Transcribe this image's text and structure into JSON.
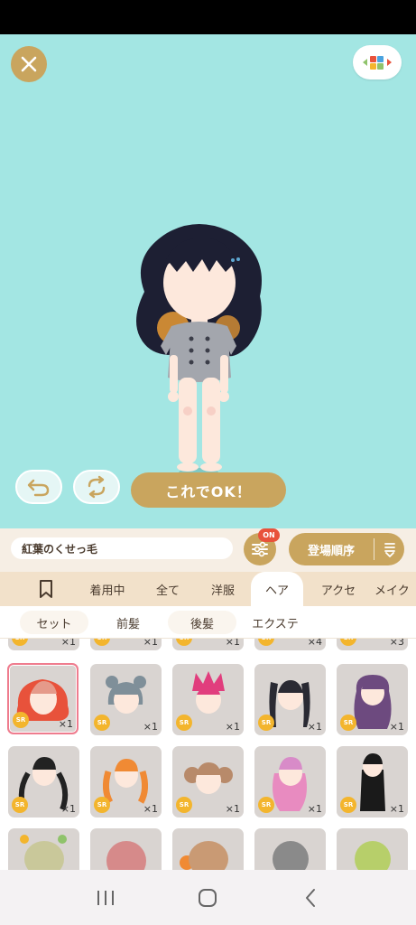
{
  "colors": {
    "stage_bg": "#a3e6e3",
    "gold": "#c9a55e",
    "badge_red": "#e8523b",
    "tab_bar": "#f2e1ca",
    "selected_border": "#ef7c8e"
  },
  "header": {
    "close_icon": "close-x-icon",
    "palette_icon": "color-palette-icon"
  },
  "actions": {
    "undo_icon": "undo-arrow-icon",
    "swap_icon": "swap-cycle-icon",
    "ok_label": "これでOK！"
  },
  "toolbar": {
    "item_name": "紅葉のくせっ毛",
    "filter_badge": "ON",
    "sort_label": "登場順序"
  },
  "category_tabs": [
    {
      "label": "",
      "icon": "bookmark-icon"
    },
    {
      "label": "着用中"
    },
    {
      "label": "全て"
    },
    {
      "label": "洋服"
    },
    {
      "label": "ヘア"
    },
    {
      "label": "アクセ"
    },
    {
      "label": "メイク"
    }
  ],
  "sub_tabs": [
    {
      "label": "セット"
    },
    {
      "label": "前髪"
    },
    {
      "label": "後髪"
    },
    {
      "label": "エクステ"
    }
  ],
  "items": {
    "top_row_qty": [
      "×1",
      "×1",
      "×1",
      "×4",
      "×3"
    ],
    "rows": [
      [
        {
          "rarity": "SR",
          "qty": "×1",
          "hair": "#e96d3d"
        },
        {
          "rarity": "SR",
          "qty": "×1",
          "hair": "#7f8f99"
        },
        {
          "rarity": "SR",
          "qty": "×1",
          "hair": "#e13d7d"
        },
        {
          "rarity": "SR",
          "qty": "×1",
          "hair": "#2a2a33"
        },
        {
          "rarity": "SR",
          "qty": "×1",
          "hair": "#6d4a7f"
        }
      ],
      [
        {
          "rarity": "SR",
          "qty": "×1",
          "hair": "#222222"
        },
        {
          "rarity": "SR",
          "qty": "×1",
          "hair": "#f08a34"
        },
        {
          "rarity": "SR",
          "qty": "×1",
          "hair": "#b88a6a"
        },
        {
          "rarity": "SR",
          "qty": "×1",
          "hair": "#e88bc0"
        },
        {
          "rarity": "SR",
          "qty": "×1",
          "hair": "#1a1a1a"
        }
      ]
    ]
  },
  "system_nav": {
    "recents_icon": "recents-icon",
    "home_icon": "home-icon",
    "back_icon": "back-chevron-icon"
  }
}
